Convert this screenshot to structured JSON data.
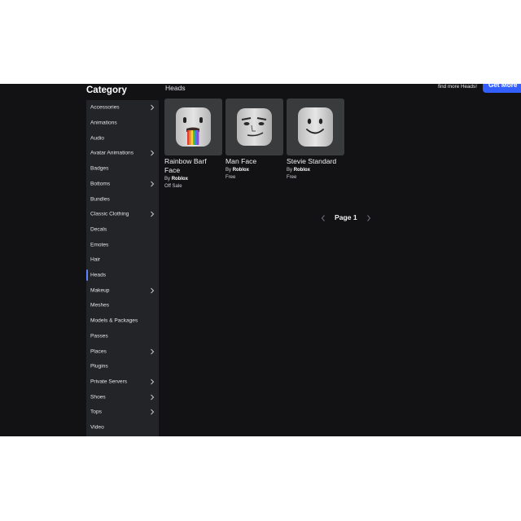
{
  "sidebar": {
    "title": "Category",
    "items": [
      {
        "label": "Accessories",
        "has_chevron": true
      },
      {
        "label": "Animations",
        "has_chevron": false
      },
      {
        "label": "Audio",
        "has_chevron": false
      },
      {
        "label": "Avatar Animations",
        "has_chevron": true
      },
      {
        "label": "Badges",
        "has_chevron": false
      },
      {
        "label": "Bottoms",
        "has_chevron": true
      },
      {
        "label": "Bundles",
        "has_chevron": false
      },
      {
        "label": "Classic Clothing",
        "has_chevron": true
      },
      {
        "label": "Decals",
        "has_chevron": false
      },
      {
        "label": "Emotes",
        "has_chevron": false
      },
      {
        "label": "Hair",
        "has_chevron": false
      },
      {
        "label": "Heads",
        "has_chevron": false,
        "active": true
      },
      {
        "label": "Makeup",
        "has_chevron": true
      },
      {
        "label": "Meshes",
        "has_chevron": false
      },
      {
        "label": "Models & Packages",
        "has_chevron": false
      },
      {
        "label": "Passes",
        "has_chevron": false
      },
      {
        "label": "Places",
        "has_chevron": true
      },
      {
        "label": "Plugins",
        "has_chevron": false
      },
      {
        "label": "Private Servers",
        "has_chevron": true
      },
      {
        "label": "Shoes",
        "has_chevron": true
      },
      {
        "label": "Tops",
        "has_chevron": true
      },
      {
        "label": "Video",
        "has_chevron": false
      }
    ]
  },
  "header": {
    "section_title": "Heads",
    "find_more_text": "find more Heads!",
    "get_more_label": "Get More"
  },
  "items": [
    {
      "name": "Rainbow Barf Face",
      "by_prefix": "By",
      "creator": "Roblox",
      "price": "Off Sale",
      "icon": "rainbow-barf-face-icon"
    },
    {
      "name": "Man Face",
      "by_prefix": "By",
      "creator": "Roblox",
      "price": "Free",
      "icon": "man-face-icon"
    },
    {
      "name": "Stevie Standard",
      "by_prefix": "By",
      "creator": "Roblox",
      "price": "Free",
      "icon": "smile-face-icon"
    }
  ],
  "pagination": {
    "label": "Page 1"
  },
  "colors": {
    "background": "#121215",
    "sidebar": "#232428",
    "accent": "#335fff",
    "active_bar": "#5e83ff",
    "card": "#393b3d"
  }
}
